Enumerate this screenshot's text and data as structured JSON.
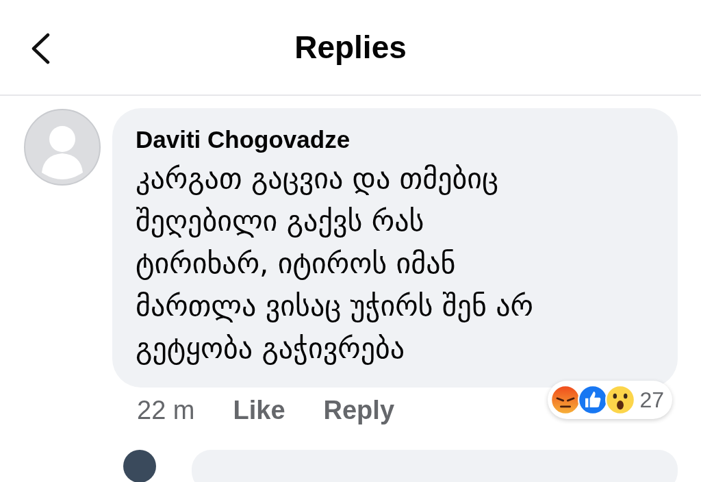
{
  "header": {
    "title": "Replies"
  },
  "comment": {
    "author": "Daviti Chogovadze",
    "text": "კარგათ გაცვია და თმებიც შეღებილი გაქვს რას ტირიხარ, იტიროს იმან მართლა ვისაც უჭირს შენ არ გეტყობა გაჭივრება",
    "time": "22 m",
    "actions": [
      "Like",
      "Reply"
    ],
    "reactions": [
      {
        "kind": "angry"
      },
      {
        "kind": "like"
      },
      {
        "kind": "wow"
      }
    ],
    "reaction_count": "27"
  }
}
